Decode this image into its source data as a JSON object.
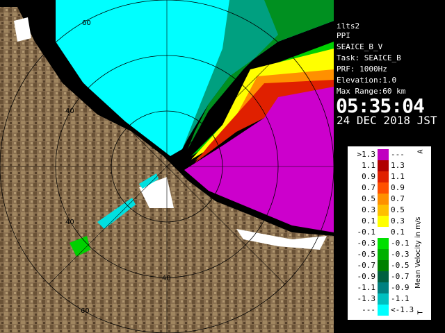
{
  "info": {
    "lines": [
      "ilts2",
      "PPI",
      "SEAICE_B_V",
      "Task: SEAICE_B",
      "PRF: 1000Hz",
      "Elevation:1.0",
      "Max Range:60 km"
    ],
    "time": "05:35:04",
    "date": "24 DEC 2018 JST"
  },
  "legend": {
    "title": "Mean Velocity in m/s",
    "arrow_top": "A",
    "arrow_bottom": "T",
    "rows": [
      {
        "left": ">1.3",
        "right": "---",
        "color": "#c000c0"
      },
      {
        "left": "1.1",
        "right": "1.3",
        "color": "#b00000"
      },
      {
        "left": "0.9",
        "right": "1.1",
        "color": "#e02000"
      },
      {
        "left": "0.7",
        "right": "0.9",
        "color": "#ff5000"
      },
      {
        "left": "0.5",
        "right": "0.7",
        "color": "#ff9000"
      },
      {
        "left": "0.3",
        "right": "0.5",
        "color": "#ffc000"
      },
      {
        "left": "0.1",
        "right": "0.3",
        "color": "#ffff00"
      },
      {
        "left": "-0.1",
        "right": "0.1",
        "color": "#ffffff"
      },
      {
        "left": "-0.3",
        "right": "-0.1",
        "color": "#00e000"
      },
      {
        "left": "-0.5",
        "right": "-0.3",
        "color": "#00b000"
      },
      {
        "left": "-0.7",
        "right": "-0.5",
        "color": "#008000"
      },
      {
        "left": "-0.9",
        "right": "-0.7",
        "color": "#006040"
      },
      {
        "left": "-1.1",
        "right": "-0.9",
        "color": "#008080"
      },
      {
        "left": "-1.3",
        "right": "-1.1",
        "color": "#00c0c0"
      },
      {
        "left": "---",
        "right": "<-1.3",
        "color": "#00ffff"
      }
    ]
  },
  "map": {
    "ring_labels": [
      "60",
      "40",
      "40",
      "40",
      "60"
    ],
    "colors": {
      "land": "#8a7050",
      "land_dark": "#5a4530",
      "background": "#000000",
      "ring": "#000000"
    }
  }
}
